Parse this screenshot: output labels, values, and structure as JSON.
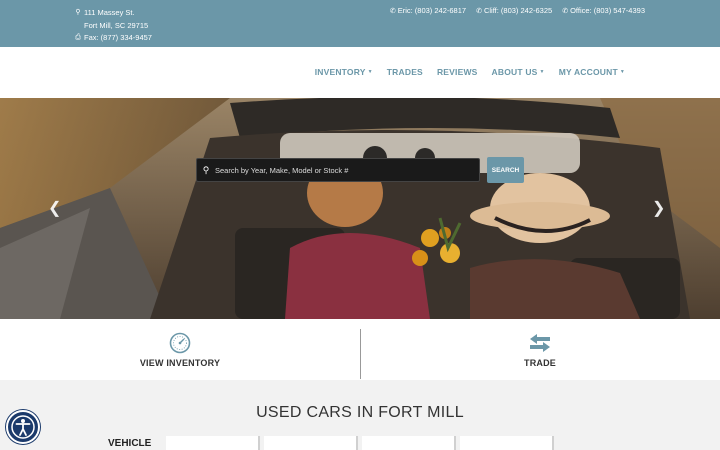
{
  "topbar": {
    "address_line1": "111 Massey St.",
    "address_line2": "Fort Mill, SC 29715",
    "fax": "Fax: (877) 334-9457",
    "phones": [
      {
        "label": "Eric: (803) 242-6817"
      },
      {
        "label": "Cliff: (803) 242-6325"
      },
      {
        "label": "Office: (803) 547-4393"
      }
    ]
  },
  "nav": {
    "items": [
      {
        "label": "INVENTORY",
        "dropdown": true
      },
      {
        "label": "TRADES",
        "dropdown": false
      },
      {
        "label": "REVIEWS",
        "dropdown": false
      },
      {
        "label": "ABOUT US",
        "dropdown": true
      },
      {
        "label": "MY ACCOUNT",
        "dropdown": true
      }
    ]
  },
  "hero": {
    "search_placeholder": "Search by Year, Make, Model or Stock #",
    "search_button": "SEARCH"
  },
  "quick_links": {
    "view_inventory": "VIEW INVENTORY",
    "trade": "TRADE"
  },
  "main": {
    "heading": "USED CARS IN FORT MILL",
    "vehicle_label": "VEHICLE"
  },
  "colors": {
    "accent": "#6b97a8",
    "accessibility": "#1b3a6b"
  }
}
